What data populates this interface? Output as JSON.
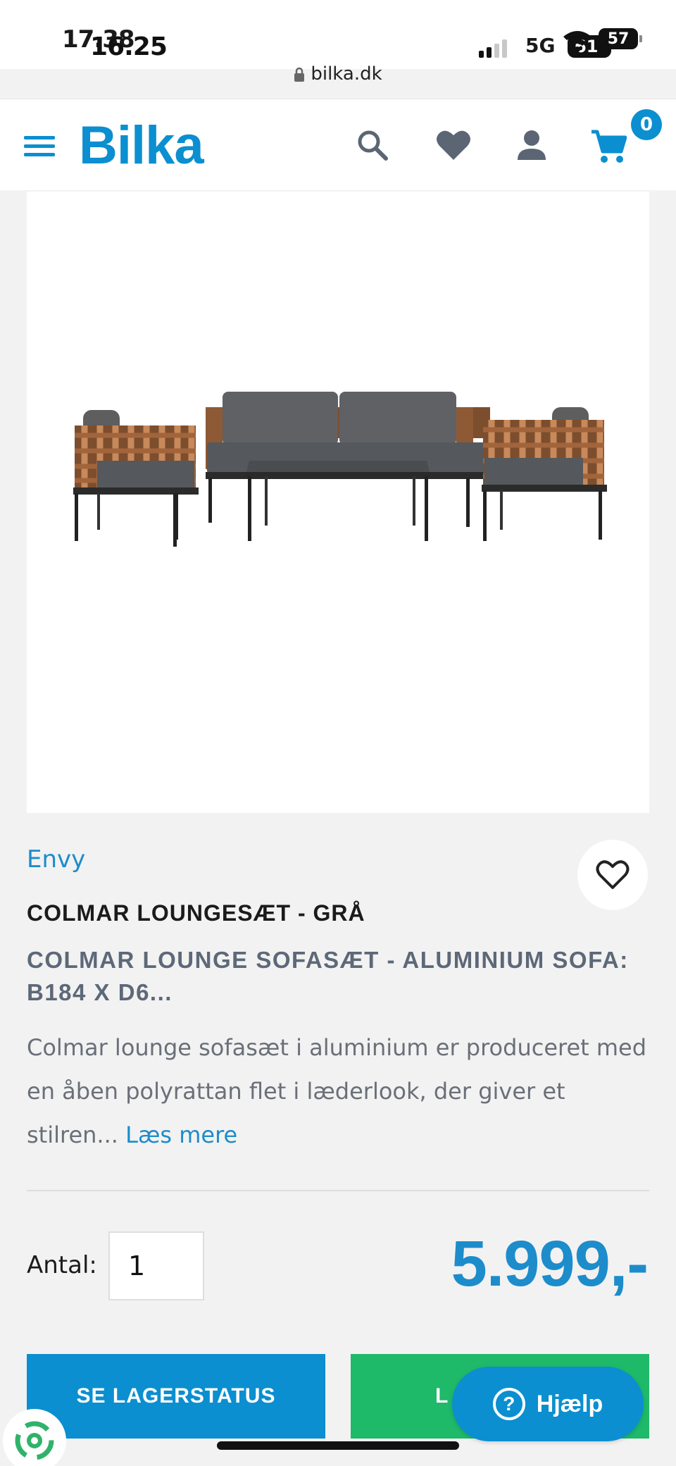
{
  "status_bar": {
    "time": "17.38",
    "time_overlay": "16.25",
    "network": "5G",
    "battery": "57",
    "battery_overlay": "61"
  },
  "browser": {
    "url": "bilka.dk"
  },
  "header": {
    "logo": "Bilka",
    "cart_count": "0",
    "brand_color": "#0b8fd0"
  },
  "product": {
    "brand": "Envy",
    "title": "COLMAR LOUNGESÆT - GRÅ",
    "subtitle": "COLMAR LOUNGE SOFASÆT - ALUMINIUM SOFA: B184 X D6...",
    "description": "Colmar lounge sofasæt i aluminium er produceret med en åben polyrattan flet i læderlook, der giver et stilren...",
    "read_more": "Læs mere",
    "image_alt": "Colmar loungesæt med sofa, to lænestole og sofabord"
  },
  "purchase": {
    "quantity_label": "Antal:",
    "quantity_value": "1",
    "price": "5.999,-",
    "stock_button": "SE LAGERSTATUS",
    "add_button": "LÆG I KURV",
    "add_button_visible": "L",
    "help_button": "Hjælp"
  },
  "colors": {
    "accent": "#0b8fd0",
    "link": "#1d8ccb",
    "add_to_cart": "#1fb96a"
  }
}
